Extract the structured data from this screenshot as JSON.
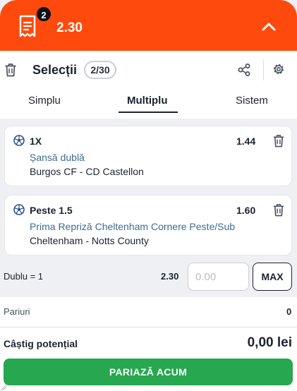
{
  "header": {
    "badge_count": "2",
    "total_odds": "2.30"
  },
  "toolbar": {
    "title": "Selecții",
    "count": "2/30"
  },
  "tabs": [
    {
      "label": "Simplu",
      "active": false
    },
    {
      "label": "Multiplu",
      "active": true
    },
    {
      "label": "Sistem",
      "active": false
    }
  ],
  "selections": [
    {
      "pick": "1X",
      "odds": "1.44",
      "market": "Șansă dublă",
      "match": "Burgos CF - CD Castellon"
    },
    {
      "pick": "Peste 1.5",
      "odds": "1.60",
      "market": "Prima Repriză Cheltenham Cornere Peste/Sub",
      "match": "Cheltenham - Notts County"
    }
  ],
  "stake_row": {
    "label": "Dublu = 1",
    "odds": "2.30",
    "placeholder": "0.00",
    "max_label": "MAX"
  },
  "summary": {
    "bets_label": "Pariuri",
    "bets_value": "0",
    "win_label": "Câștig potențial",
    "win_value": "0,00 lei",
    "cta_label": "PARIAZĂ ACUM"
  },
  "colors": {
    "header": "#ff4a0d",
    "market_text": "#3c6c92",
    "cta": "#27a74f",
    "icon_blue": "#2a4f8f"
  },
  "icons": [
    "betslip-icon",
    "chevron-up-icon",
    "trash-icon",
    "share-icon",
    "gear-icon",
    "soccer-ball-icon"
  ]
}
